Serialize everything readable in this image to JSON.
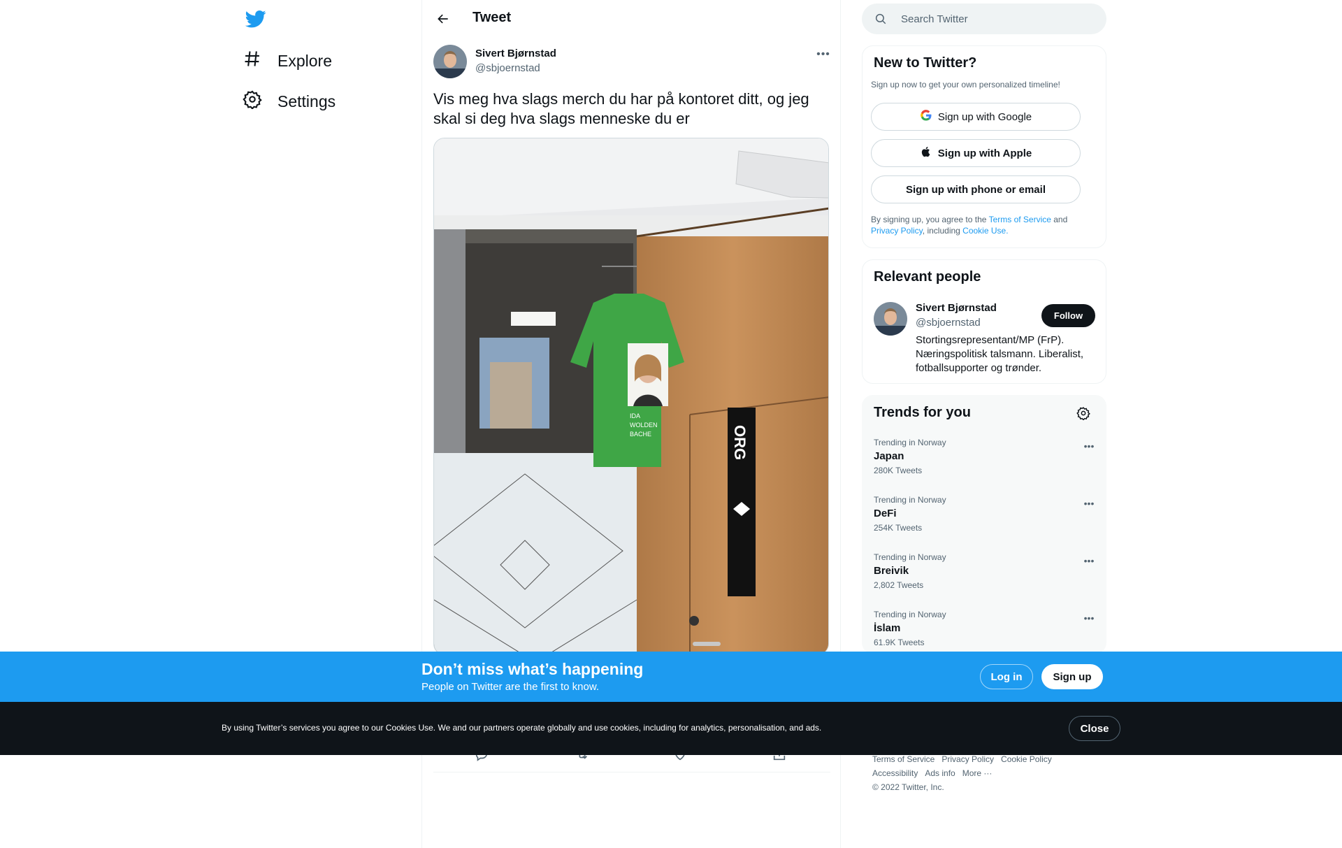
{
  "nav": {
    "items": [
      {
        "label": "Explore",
        "icon": "hashtag-icon"
      },
      {
        "label": "Settings",
        "icon": "gear-icon"
      }
    ]
  },
  "header": {
    "title": "Tweet"
  },
  "tweet": {
    "author_name": "Sivert Bjørnstad",
    "author_handle": "@sbjoernstad",
    "text": "Vis meg hva slags merch du har på kontoret ditt, og jeg skal si deg hva slags menneske du er",
    "photo": {
      "shirt_text": [
        "IDA",
        "WOLDEN",
        "BACHE"
      ],
      "scarf_text": "ORG"
    }
  },
  "search": {
    "placeholder": "Search Twitter"
  },
  "new_to_twitter": {
    "title": "New to Twitter?",
    "subtitle": "Sign up now to get your own personalized timeline!",
    "google_label": "Sign up with Google",
    "apple_label": "Sign up with Apple",
    "phone_label": "Sign up with phone or email",
    "legal_prefix": "By signing up, you agree to the ",
    "terms": "Terms of Service",
    "and": " and ",
    "privacy": "Privacy Policy",
    "including": ", including ",
    "cookie": "Cookie Use."
  },
  "relevant_people": {
    "title": "Relevant people",
    "name": "Sivert Bjørnstad",
    "handle": "@sbjoernstad",
    "follow_label": "Follow",
    "bio": "Stortingsrepresentant/MP (FrP). Næringspolitisk talsmann. Liberalist, fotballsupporter og trønder."
  },
  "trends": {
    "title": "Trends for you",
    "items": [
      {
        "context": "Trending in Norway",
        "name": "Japan",
        "count": "280K Tweets"
      },
      {
        "context": "Trending in Norway",
        "name": "DeFi",
        "count": "254K Tweets"
      },
      {
        "context": "Trending in Norway",
        "name": "Breivik",
        "count": "2,802 Tweets"
      },
      {
        "context": "Trending in Norway",
        "name": "İslam",
        "count": "61.9K Tweets"
      }
    ]
  },
  "footer": {
    "terms": "Terms of Service",
    "privacy": "Privacy Policy",
    "cookie": "Cookie Policy",
    "accessibility": "Accessibility",
    "ads": "Ads info",
    "more": "More ···",
    "copyright": "© 2022 Twitter, Inc."
  },
  "banner": {
    "title": "Don’t miss what’s happening",
    "subtitle": "People on Twitter are the first to know.",
    "login_label": "Log in",
    "signup_label": "Sign up"
  },
  "cookie_banner": {
    "text": "By using Twitter’s services you agree to our Cookies Use. We and our partners operate globally and use cookies, including for analytics, personalisation, and ads.",
    "close_label": "Close"
  },
  "colors": {
    "brand": "#1d9bf0",
    "text": "#0f1419",
    "secondary": "#536471",
    "dark_banner": "#0f1419"
  }
}
